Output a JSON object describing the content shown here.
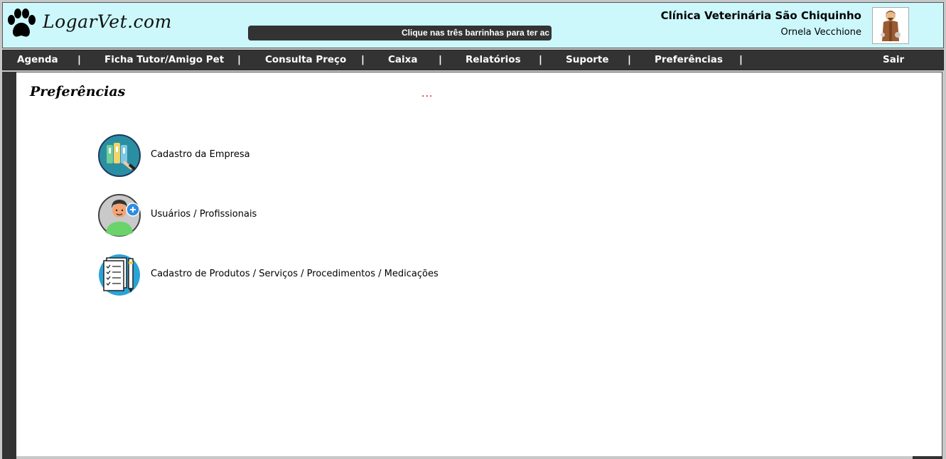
{
  "header": {
    "logo_text": "LogarVet.com",
    "marquee_text": "Clique nas três barrinhas para ter ac",
    "clinic_name": "Clínica Veterinária São Chiquinho",
    "user_name": "Ornela Vecchione",
    "avatar_icon": "saint-francis-avatar-icon"
  },
  "nav": {
    "items": [
      "Agenda",
      "Ficha Tutor/Amigo Pet",
      "Consulta Preço",
      "Caixa",
      "Relatórios",
      "Suporte",
      "Preferências"
    ],
    "separator": "|",
    "logout": "Sair"
  },
  "page": {
    "title": "Preferências",
    "loading_dots": "...",
    "options": [
      {
        "label": "Cadastro da Empresa",
        "icon": "folders-icon"
      },
      {
        "label": "Usuários / Profissionais",
        "icon": "add-user-icon"
      },
      {
        "label": "Cadastro de Produtos / Serviços / Procedimentos / Medicações",
        "icon": "checklist-icon"
      }
    ]
  },
  "colors": {
    "header_bg": "#ccf8fc",
    "nav_bg": "#333333",
    "dots": "#cc0000"
  }
}
